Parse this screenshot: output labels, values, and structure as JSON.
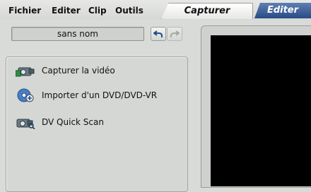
{
  "menu": {
    "items": [
      "Fichier",
      "Editer",
      "Clip",
      "Outils"
    ]
  },
  "tabs": {
    "capture": "Capturer",
    "edit": "Editer"
  },
  "project": {
    "title": "sans nom"
  },
  "actions": [
    {
      "label": "Capturer la vidéo",
      "icon": "camera-capture-icon"
    },
    {
      "label": "Importer d'un DVD/DVD-VR",
      "icon": "dvd-import-icon"
    },
    {
      "label": "DV Quick Scan",
      "icon": "dv-quick-scan-icon"
    }
  ],
  "colors": {
    "accent_tab": "#284a86",
    "background": "#d9dbd8",
    "preview": "#000000"
  }
}
